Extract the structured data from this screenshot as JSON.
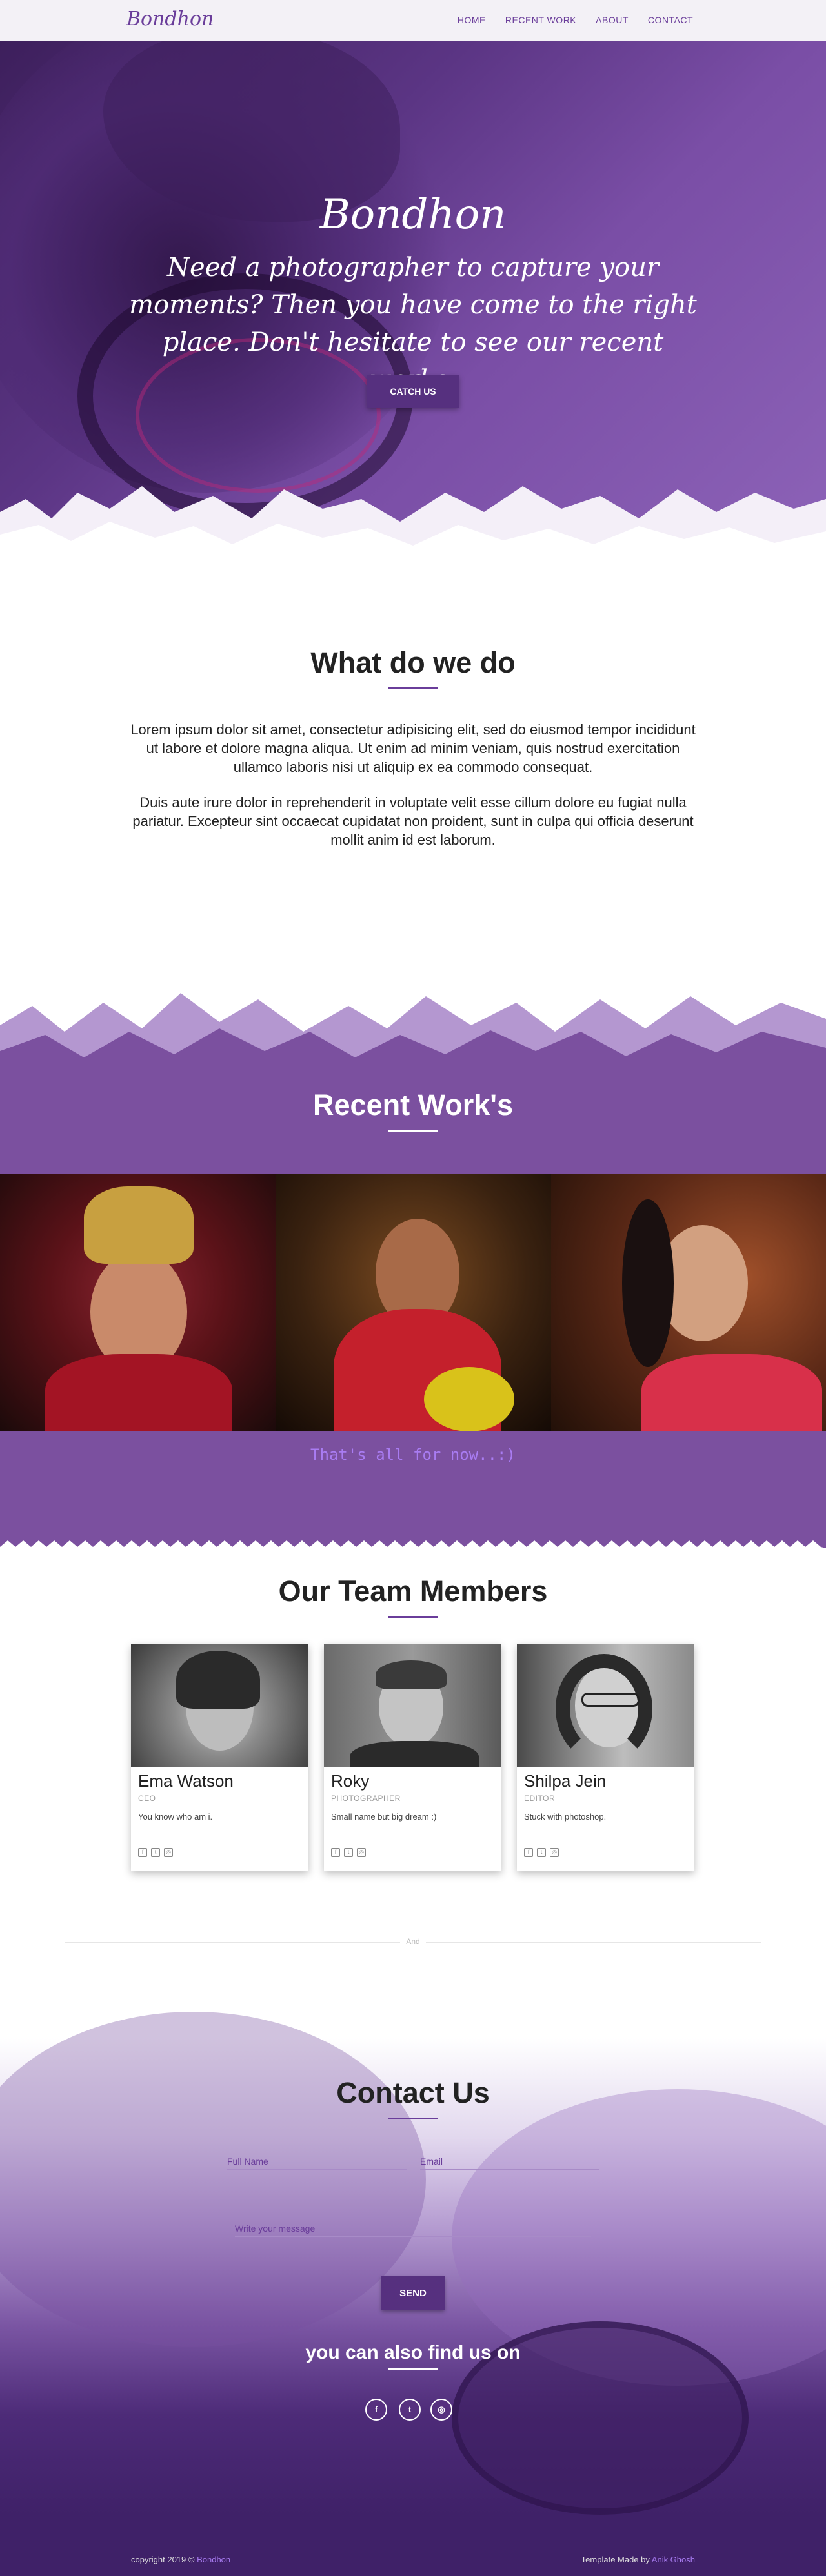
{
  "brand": "Bondhon",
  "nav": {
    "items": [
      "HOME",
      "RECENT WORK",
      "ABOUT",
      "CONTACT"
    ]
  },
  "hero": {
    "title": "Bondhon",
    "subtitle": "Need a photographer to capture your moments? Then you have come to the right place. Don't hesitate to see our recent works.",
    "button": "CATCH US"
  },
  "what": {
    "title": "What do we do",
    "p1": "Lorem ipsum dolor sit amet, consectetur adipisicing elit, sed do eiusmod tempor incididunt ut labore et dolore magna aliqua. Ut enim ad minim veniam, quis nostrud exercitation ullamco laboris nisi ut aliquip ex ea commodo consequat.",
    "p2": "Duis aute irure dolor in reprehenderit in voluptate velit esse cillum dolore eu fugiat nulla pariatur. Excepteur sint occaecat cupidatat non proident, sunt in culpa qui officia deserunt mollit anim id est laborum."
  },
  "works": {
    "title": "Recent Work's",
    "note": "That's all for now..:)",
    "photos": [
      "bride-portrait-1",
      "bride-portrait-2",
      "bride-portrait-3"
    ]
  },
  "team": {
    "title": "Our Team Members",
    "members": [
      {
        "name": "Ema Watson",
        "role": "CEO",
        "desc": "You know who am i."
      },
      {
        "name": "Roky",
        "role": "PHOTOGRAPHER",
        "desc": "Small name but big dream :)"
      },
      {
        "name": "Shilpa Jein",
        "role": "EDITOR",
        "desc": "Stuck with photoshop."
      }
    ],
    "social_icons": [
      "facebook-icon",
      "twitter-icon",
      "instagram-icon"
    ]
  },
  "divider": "And",
  "contact": {
    "title": "Contact Us",
    "fullname_placeholder": "Full Name",
    "email_placeholder": "Email",
    "message_placeholder": "Write your message",
    "send": "SEND",
    "find_title": "you can also find us on",
    "socials": [
      "f",
      "t",
      "◎"
    ]
  },
  "footer": {
    "copyright": "copyright 2019 © ",
    "copyright_link": "Bondhon",
    "made_by": "Template Made by ",
    "made_by_link": "Anik Ghosh"
  },
  "colors": {
    "accent": "#6a3d9a",
    "button": "#56307f",
    "works_bg": "#7b509f",
    "note": "#a97cf2"
  }
}
